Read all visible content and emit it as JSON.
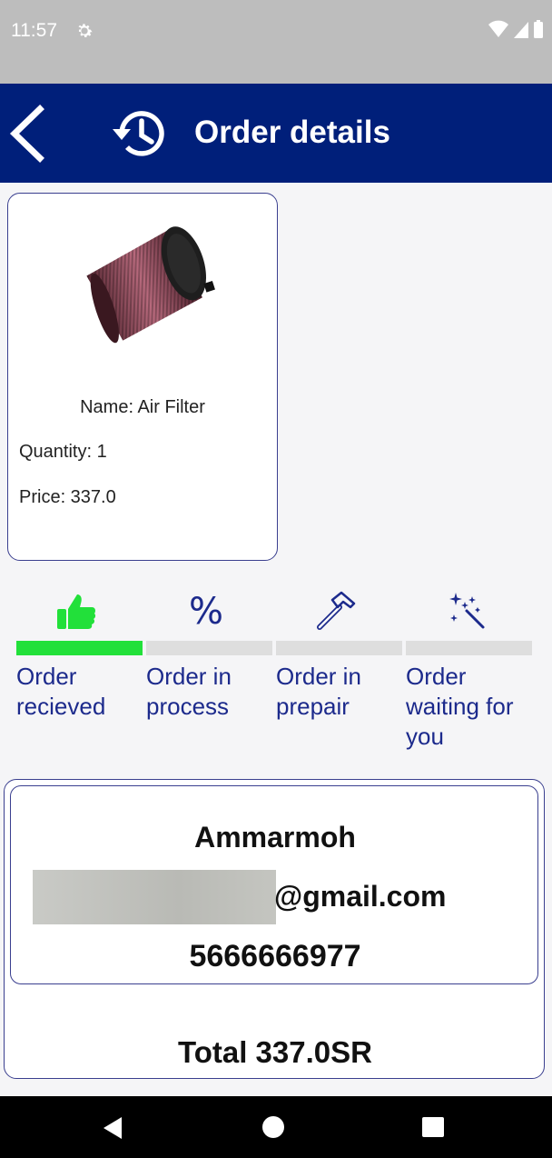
{
  "status_bar": {
    "time": "11:57"
  },
  "app_bar": {
    "title": "Order details"
  },
  "product": {
    "name": "Name: Air Filter",
    "quantity": "Quantity: 1",
    "price": "Price: 337.0"
  },
  "steps": [
    {
      "label": "Order recieved",
      "icon": "thumbs-up-icon",
      "progress": 1
    },
    {
      "label": "Order in process",
      "icon": "percent-icon",
      "progress": 0
    },
    {
      "label": "Order in prepair",
      "icon": "hammer-icon",
      "progress": 0
    },
    {
      "label": "Order waiting for you",
      "icon": "sparkle-wand-icon",
      "progress": 0
    }
  ],
  "customer": {
    "name": "Ammarmoh",
    "email_visible": "@gmail.com",
    "phone": "5666666977"
  },
  "total": "Total 337.0SR",
  "colors": {
    "app_bar": "#001f7a",
    "accent_text": "#1c2a8c",
    "progress_active": "#22e03a",
    "progress_inactive": "#dedede"
  }
}
